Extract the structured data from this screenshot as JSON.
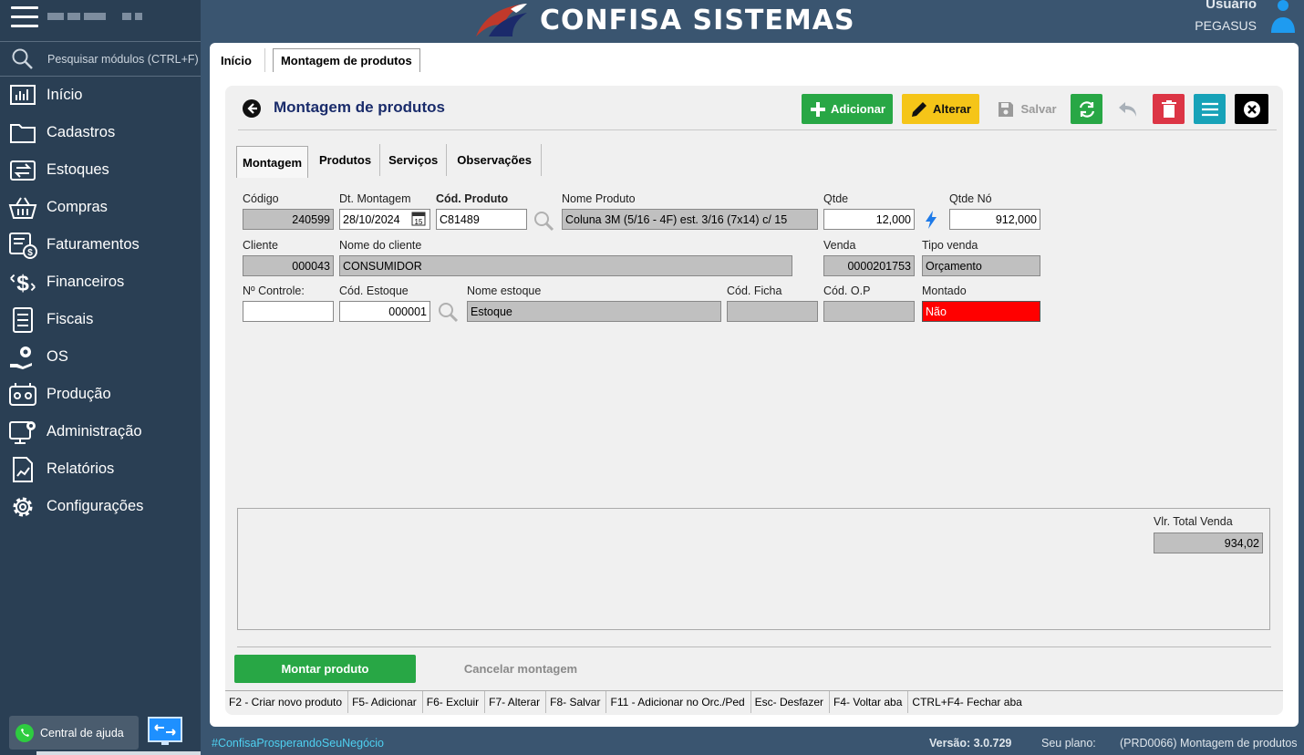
{
  "app": {
    "brand": "CONFISA SISTEMAS",
    "user_label": "Usuário",
    "user_name": "PEGASUS"
  },
  "sidebar": {
    "search_placeholder": "Pesquisar módulos (CTRL+F)",
    "items": [
      {
        "label": "Início",
        "icon": "dashboard-icon"
      },
      {
        "label": "Cadastros",
        "icon": "folder-icon"
      },
      {
        "label": "Estoques",
        "icon": "transfer-icon"
      },
      {
        "label": "Compras",
        "icon": "basket-icon"
      },
      {
        "label": "Faturamentos",
        "icon": "invoice-icon"
      },
      {
        "label": "Financeiros",
        "icon": "dollar-icon"
      },
      {
        "label": "Fiscais",
        "icon": "document-list-icon"
      },
      {
        "label": "OS",
        "icon": "service-icon"
      },
      {
        "label": "Produção",
        "icon": "production-icon"
      },
      {
        "label": "Administração",
        "icon": "admin-monitor-icon"
      },
      {
        "label": "Relatórios",
        "icon": "report-icon"
      },
      {
        "label": "Configurações",
        "icon": "gear-icon"
      }
    ],
    "help_label": "Central de ajuda"
  },
  "top_tabs": [
    "Início",
    "Montagem de produtos"
  ],
  "page": {
    "title": "Montagem de produtos",
    "toolbar": {
      "add": "Adicionar",
      "edit": "Alterar",
      "save": "Salvar"
    },
    "inner_tabs": [
      "Montagem",
      "Produtos",
      "Serviços",
      "Observações"
    ]
  },
  "form": {
    "codigo_label": "Código",
    "codigo": "240599",
    "dt_label": "Dt. Montagem",
    "dt": "28/10/2024",
    "cod_produto_label": "Cód. Produto",
    "cod_produto": "C81489",
    "nome_produto_label": "Nome Produto",
    "nome_produto": "Coluna 3M (5/16 - 4F) est. 3/16 (7x14) c/ 15",
    "qtde_label": "Qtde",
    "qtde": "12,000",
    "qtde_no_label": "Qtde Nó",
    "qtde_no": "912,000",
    "cliente_label": "Cliente",
    "cliente": "000043",
    "nome_cliente_label": "Nome do cliente",
    "nome_cliente": "CONSUMIDOR",
    "venda_label": "Venda",
    "venda": "0000201753",
    "tipo_venda_label": "Tipo venda",
    "tipo_venda": "Orçamento",
    "controle_label": "Nº Controle:",
    "controle": "",
    "cod_estoque_label": "Cód. Estoque",
    "cod_estoque": "000001",
    "nome_estoque_label": "Nome estoque",
    "nome_estoque": "Estoque",
    "cod_ficha_label": "Cód. Ficha",
    "cod_ficha": "",
    "cod_op_label": "Cód. O.P",
    "cod_op": "",
    "montado_label": "Montado",
    "montado": "Não",
    "vlr_total_label": "Vlr. Total Venda",
    "vlr_total": "934,02"
  },
  "actions": {
    "montar": "Montar produto",
    "cancelar": "Cancelar montagem"
  },
  "shortcuts": [
    "F2 - Criar novo produto",
    "F5- Adicionar",
    "F6- Excluir",
    "F7- Alterar",
    "F8- Salvar",
    "F11 - Adicionar no Orc./Ped",
    "Esc- Desfazer",
    "F4- Voltar aba",
    "CTRL+F4- Fechar aba"
  ],
  "footer": {
    "hashtag": "#ConfisaProsperandoSeuNegócio",
    "version": "Versão: 3.0.729",
    "plan_label": "Seu plano:",
    "screen_code": "(PRD0066) Montagem de produtos"
  },
  "colors": {
    "sidebar": "#2a3f54",
    "header": "#3a5570",
    "add_button": "#28a745",
    "edit_button": "#f5c518",
    "delete_button": "#dc3545",
    "menu_button": "#17a2b8",
    "montado_no": "#ff0000"
  }
}
